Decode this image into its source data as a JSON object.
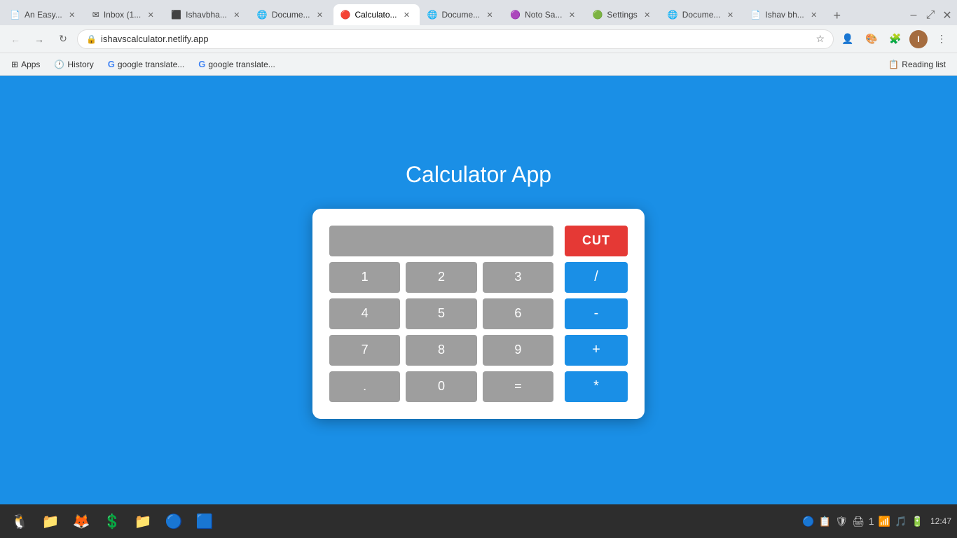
{
  "browser": {
    "url": "ishavscalculator.netlify.app",
    "tabs": [
      {
        "id": "t1",
        "label": "An Easy...",
        "favicon": "📄",
        "active": false
      },
      {
        "id": "t2",
        "label": "Inbox (1...",
        "favicon": "✉",
        "active": false
      },
      {
        "id": "t3",
        "label": "Ishavbha...",
        "favicon": "⬛",
        "active": false
      },
      {
        "id": "t4",
        "label": "Docume...",
        "favicon": "🌐",
        "active": false
      },
      {
        "id": "t5",
        "label": "Calculato...",
        "favicon": "🔴",
        "active": true
      },
      {
        "id": "t6",
        "label": "Docume...",
        "favicon": "🌐",
        "active": false
      },
      {
        "id": "t7",
        "label": "Noto Sa...",
        "favicon": "🟣",
        "active": false
      },
      {
        "id": "t8",
        "label": "Settings",
        "favicon": "🟢",
        "active": false
      },
      {
        "id": "t9",
        "label": "Docume...",
        "favicon": "🌐",
        "active": false
      },
      {
        "id": "t10",
        "label": "Ishav bh...",
        "favicon": "📄",
        "active": false
      }
    ],
    "bookmarks": [
      {
        "label": "Apps",
        "favicon": "⊞"
      },
      {
        "label": "History",
        "favicon": "🕐"
      },
      {
        "label": "google translate...",
        "favicon": "G"
      },
      {
        "label": "google translate...",
        "favicon": "G"
      }
    ],
    "reading_list": "Reading list"
  },
  "page": {
    "title": "Calculator App",
    "calculator": {
      "display_value": "",
      "buttons": [
        {
          "label": "1"
        },
        {
          "label": "2"
        },
        {
          "label": "3"
        },
        {
          "label": "4"
        },
        {
          "label": "5"
        },
        {
          "label": "6"
        },
        {
          "label": "7"
        },
        {
          "label": "8"
        },
        {
          "label": "9"
        },
        {
          "label": "."
        },
        {
          "label": "0"
        },
        {
          "label": "="
        }
      ],
      "cut_label": "CUT",
      "operators": [
        {
          "label": "/"
        },
        {
          "label": "-"
        },
        {
          "label": "+"
        },
        {
          "label": "*"
        }
      ]
    }
  },
  "taskbar": {
    "apps": [
      {
        "name": "linux-logo",
        "icon": "🐧"
      },
      {
        "name": "files",
        "icon": "📁"
      },
      {
        "name": "firefox",
        "icon": "🦊"
      },
      {
        "name": "terminal",
        "icon": "💲"
      },
      {
        "name": "file-manager",
        "icon": "📁"
      },
      {
        "name": "chrome",
        "icon": "🔵"
      },
      {
        "name": "visual-studio",
        "icon": "🟦"
      }
    ],
    "sys_icons": [
      "🔵",
      "📋",
      "🛡",
      "🖨",
      "1",
      "📶",
      "🎵",
      "🔋"
    ],
    "time": "12:47"
  },
  "colors": {
    "page_bg": "#1a8fe6",
    "cut_btn": "#e53935",
    "op_btn": "#1a8fe6",
    "num_btn": "#9e9e9e",
    "display_bg": "#9e9e9e"
  }
}
